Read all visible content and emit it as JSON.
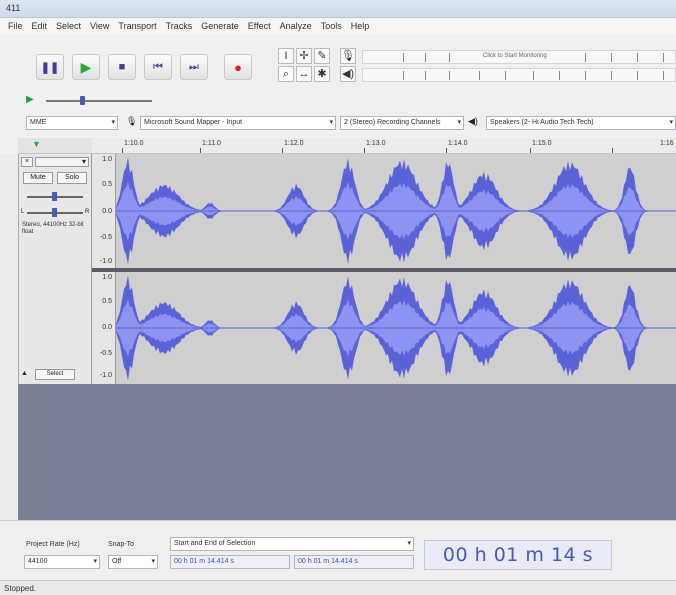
{
  "window": {
    "title": "411"
  },
  "menu": [
    "File",
    "Edit",
    "Select",
    "View",
    "Transport",
    "Tracks",
    "Generate",
    "Effect",
    "Analyze",
    "Tools",
    "Help"
  ],
  "meter": {
    "prompt": "Click to Start Monitoring"
  },
  "device_toolbar": {
    "host": "MME",
    "recording_device": "Microsoft Sound Mapper - Input",
    "channels": "2 (Stereo) Recording Channels",
    "playback_device": "Speakers (2- Hi Audio Tech Tech)"
  },
  "ruler": {
    "labels": [
      "1:10.0",
      "1:11.0",
      "1:12.0",
      "1:13.0",
      "1:14.0",
      "1:15.0",
      "1:16"
    ]
  },
  "track": {
    "mute": "Mute",
    "solo": "Solo",
    "info": "Stereo, 44100Hz 32-bit float",
    "select": "Select",
    "scale_top": [
      "1.0",
      "0.5",
      "0.0",
      "-0.5",
      "-1.0"
    ],
    "scale_bottom": [
      "1.0",
      "0.5",
      "0.0",
      "-0.5",
      "-1.0"
    ]
  },
  "selection_toolbar": {
    "project_rate_label": "Project Rate (Hz)",
    "project_rate": "44100",
    "snap_label": "Snap-To",
    "snap": "Off",
    "mode": "Start and End of Selection",
    "start": "00 h 01 m 14.414 s",
    "end": "00 h 01 m 14.414 s",
    "audio_position": "00 h 01 m 14 s"
  },
  "status": {
    "text": "Stopped."
  },
  "colors": {
    "wave_outer": "#5a62d8",
    "wave_inner": "#8c93f0",
    "track_bg": "#cfcfcf",
    "empty_bg": "#7a7e96",
    "time_text": "#4a58b8"
  }
}
